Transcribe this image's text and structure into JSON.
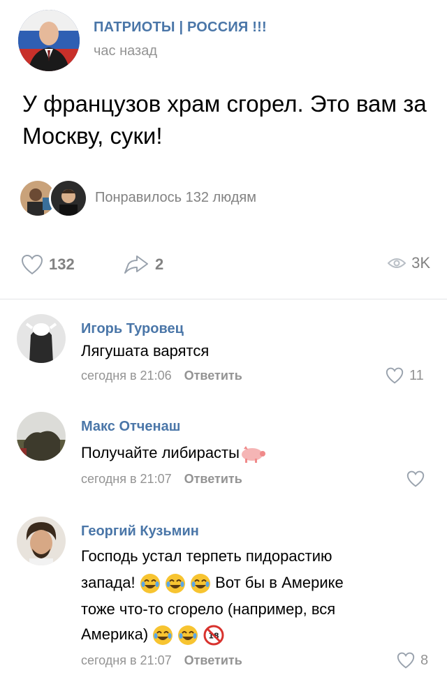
{
  "post": {
    "group_name": "ПАТРИОТЫ | РОССИЯ !!!",
    "time": "час назад",
    "text": "У французов храм сгорел. Это вам за Москву, суки!",
    "liked_by_text": "Понравилось 132 людям",
    "likes": "132",
    "shares": "2",
    "views": "3K"
  },
  "comments": [
    {
      "author": "Игорь Туровец",
      "text": "Лягушата варятся",
      "time": "сегодня в 21:06",
      "reply": "Ответить",
      "likes": "11"
    },
    {
      "author": "Макс Отченаш",
      "text": "Получайте либирасты",
      "time": "сегодня в 21:07",
      "reply": "Ответить",
      "likes": ""
    },
    {
      "author": "Георгий Кузьмин",
      "text_line1": "Господь устал терпеть пидорастию",
      "text_line2a": "запада!",
      "text_line2b": "Вот бы в Америке",
      "text_line3": "тоже что-то сгорело (например, вся",
      "text_line4": "Америка)",
      "time": "сегодня в 21:07",
      "reply": "Ответить",
      "likes": "8"
    }
  ],
  "colors": {
    "link": "#4a76a8",
    "muted": "#939393",
    "divider": "#e3e4e6"
  },
  "icons": [
    "heart-icon",
    "share-icon",
    "eye-icon",
    "laughing-emoji",
    "pig-emoji",
    "18-plus-emoji"
  ]
}
